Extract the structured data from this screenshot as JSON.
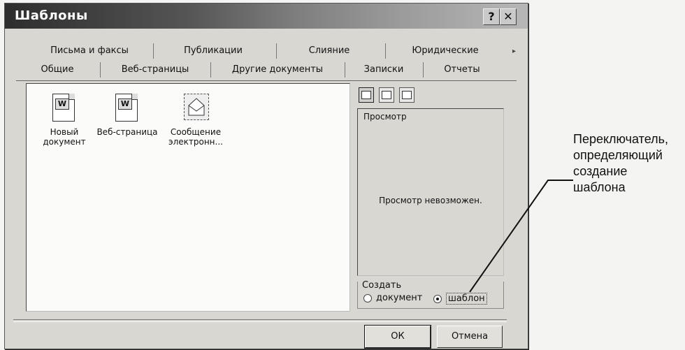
{
  "window": {
    "title": "Шаблоны",
    "help_label": "?",
    "close_label": "✕"
  },
  "tabs_row1": [
    "Письма и факсы",
    "Публикации",
    "Слияние",
    "Юридические"
  ],
  "tabs_row2": [
    "Общие",
    "Веб-страницы",
    "Другие документы",
    "Записки",
    "Отчеты"
  ],
  "active_tab": "Общие",
  "templates": [
    {
      "label": "Новый документ",
      "icon": "word-document-icon"
    },
    {
      "label": "Веб-страница",
      "icon": "web-page-icon"
    },
    {
      "label": "Сообщение электронн...",
      "icon": "email-message-icon"
    }
  ],
  "preview": {
    "label": "Просмотр",
    "message": "Просмотр невозможен."
  },
  "create": {
    "label": "Создать",
    "options": [
      "документ",
      "шаблон"
    ],
    "selected": "шаблон"
  },
  "buttons": {
    "ok": "ОК",
    "cancel": "Отмена"
  },
  "annotation": {
    "lines": [
      "Переключатель,",
      "определяющий",
      "создание",
      "шаблона"
    ]
  }
}
